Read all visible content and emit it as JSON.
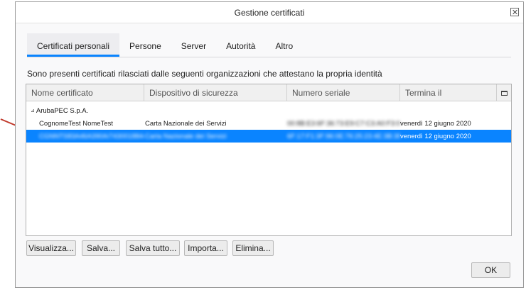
{
  "window": {
    "title": "Gestione certificati"
  },
  "tabs": [
    {
      "label": "Certificati personali",
      "active": true
    },
    {
      "label": "Persone"
    },
    {
      "label": "Server"
    },
    {
      "label": "Autorità"
    },
    {
      "label": "Altro"
    }
  ],
  "description": "Sono presenti certificati rilasciati dalle seguenti organizzazioni che attestano la propria identità",
  "columns": {
    "name": "Nome certificato",
    "device": "Dispositivo di sicurezza",
    "serial": "Numero seriale",
    "expires": "Termina il"
  },
  "group": {
    "label": "ArubaPEC S.p.A."
  },
  "rows": [
    {
      "name": "CognomeTest NomeTest",
      "device": "Carta Nazionale dei Servizi",
      "serial": "00:8B:E3:6F:36:73:E9:C7:C3:A0:F3:0F:6C:...",
      "expires": "venerdì 12 giugno 2020",
      "selected": false,
      "name_blurred": false,
      "device_blurred": false
    },
    {
      "name": "CGNNTS83A46A390A/743001884459...",
      "device": "Carta Nazionale dei Servizi",
      "serial": "6F:17:F1:3F:96:0E:76:25:23:4E:3B:38:45:...",
      "expires": "venerdì 12 giugno 2020",
      "selected": true,
      "name_blurred": true,
      "device_blurred": true
    }
  ],
  "buttons": {
    "view": "Visualizza...",
    "save": "Salva...",
    "save_all": "Salva tutto...",
    "import": "Importa...",
    "delete": "Elimina...",
    "ok": "OK"
  },
  "colors": {
    "accent": "#0a84ff",
    "annotation_arrow": "#c0392b"
  },
  "icons": {
    "close": "close-icon",
    "column_picker": "column-picker-icon",
    "twisty": "twisty-expanded-icon",
    "annotation": "red-arrow-icon"
  }
}
